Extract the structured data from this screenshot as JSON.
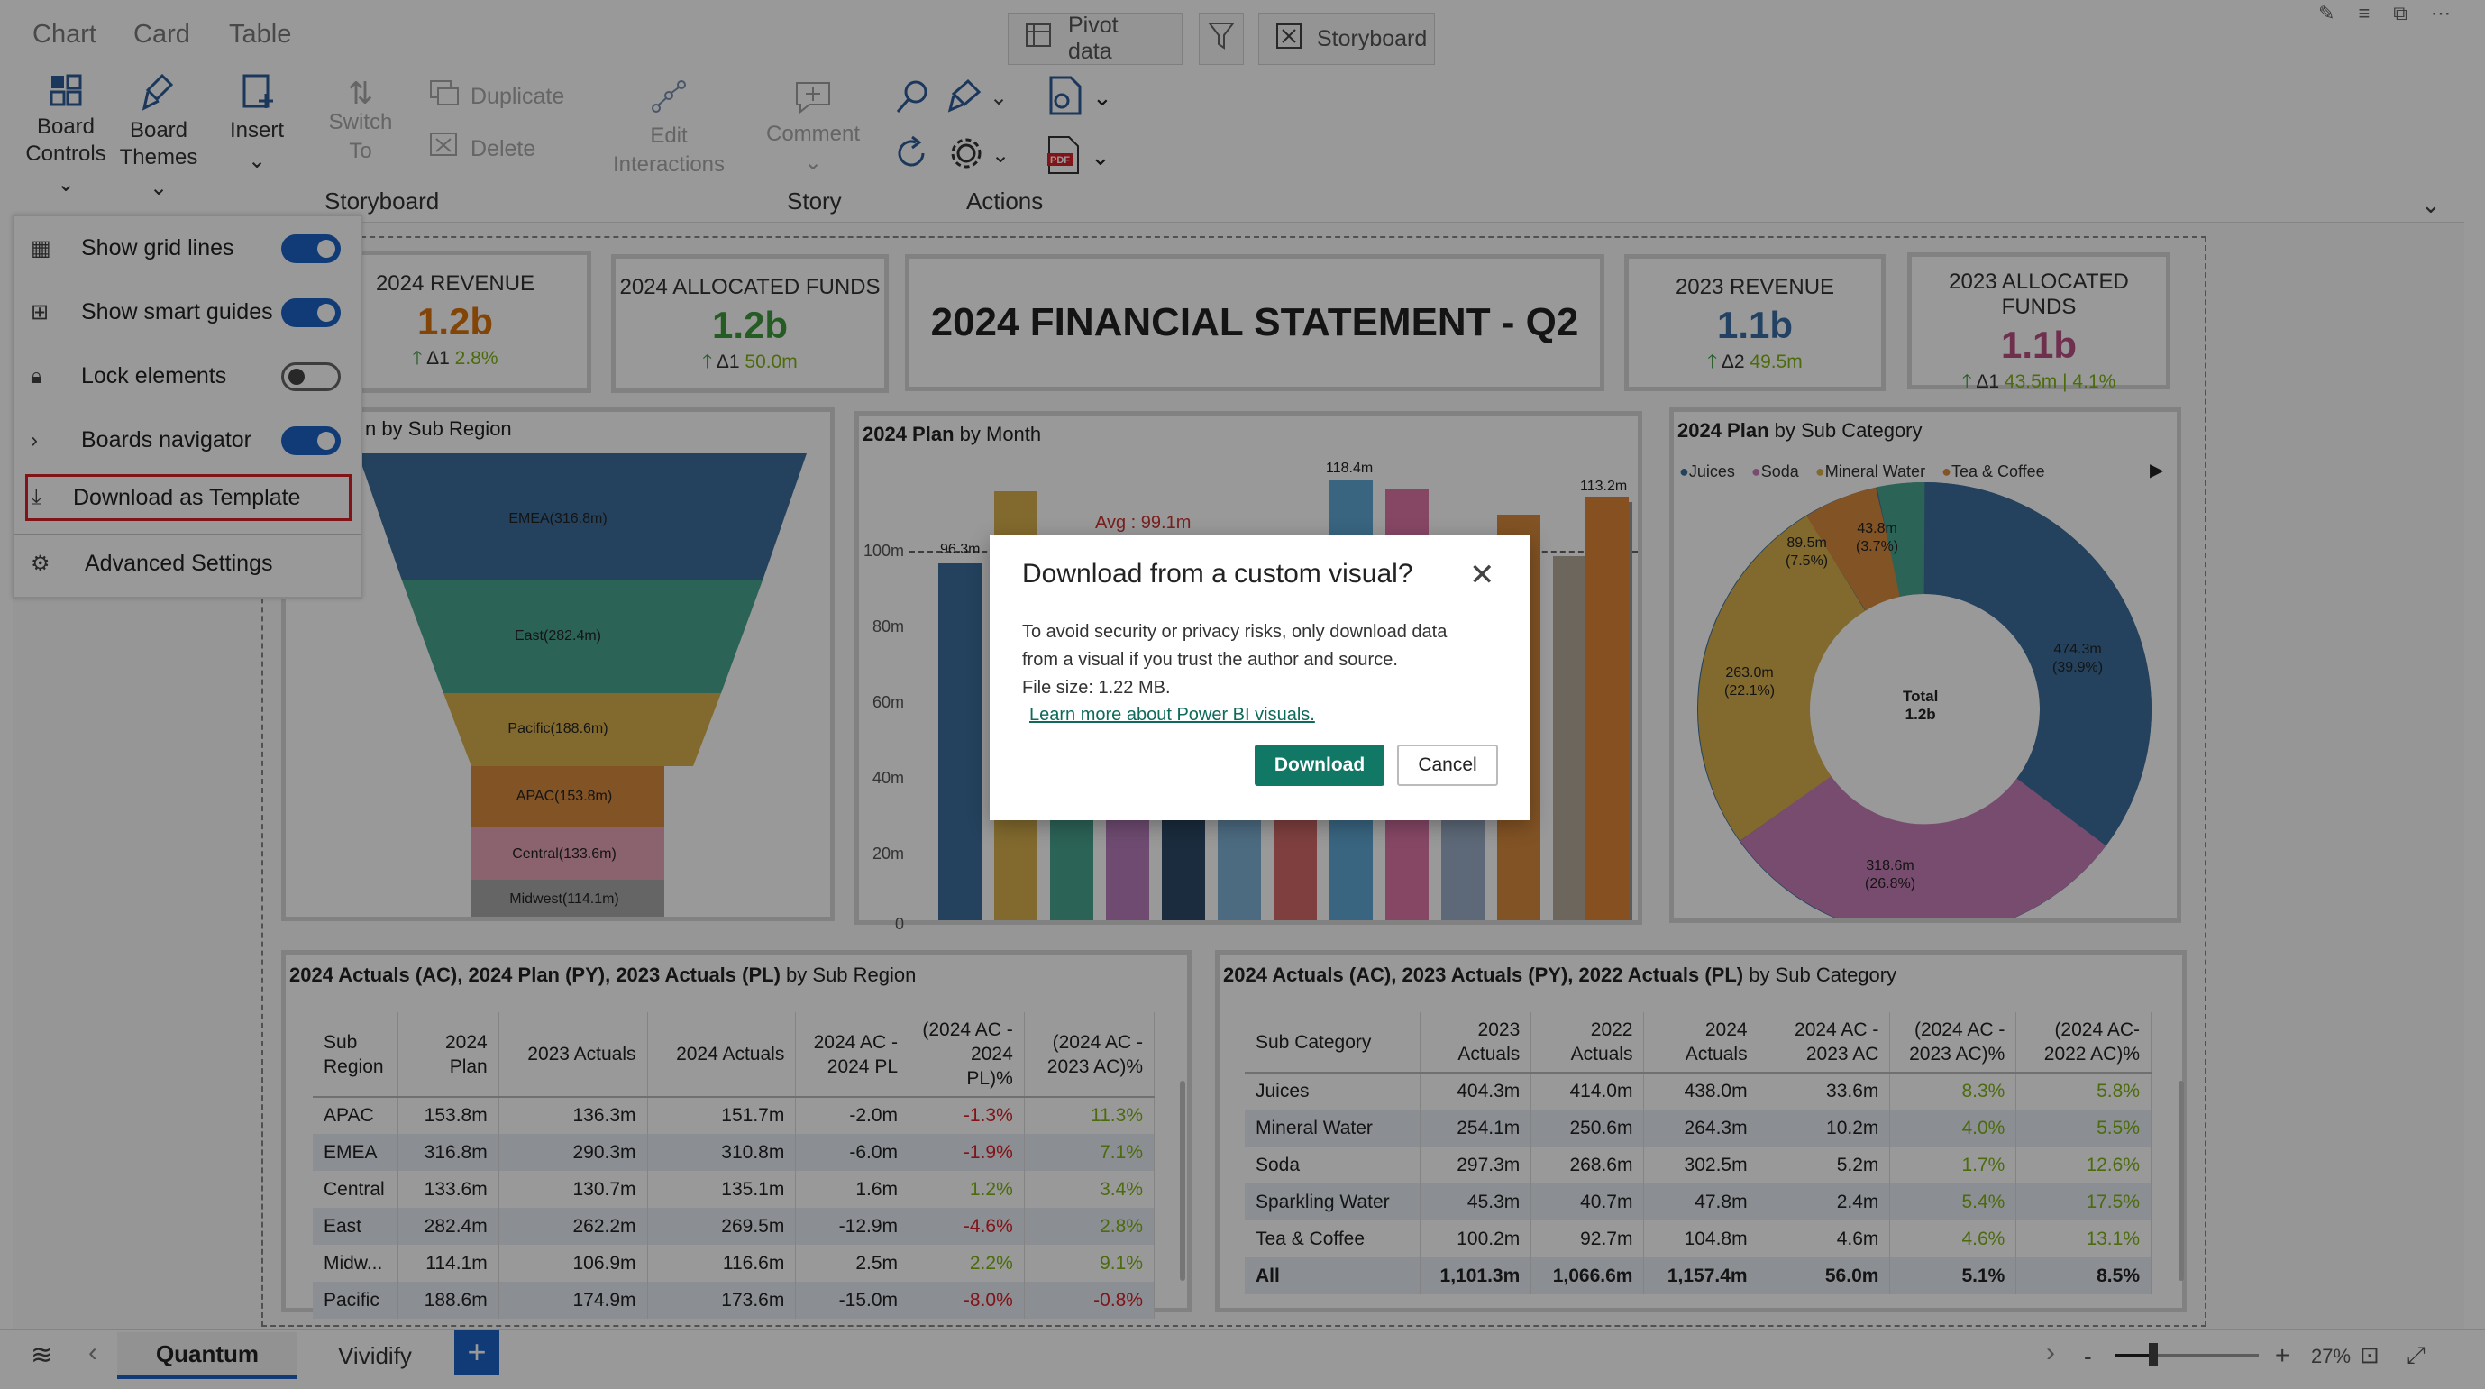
{
  "top_tabs": [
    "Chart",
    "Card",
    "Table"
  ],
  "top_buttons": {
    "pivot": "Pivot data",
    "storyboard": "Storyboard"
  },
  "ribbon": {
    "board_controls": [
      "Board",
      "Controls"
    ],
    "board_themes": [
      "Board",
      "Themes"
    ],
    "insert": "Insert",
    "switch_to": [
      "Switch",
      "To"
    ],
    "duplicate": "Duplicate",
    "delete": "Delete",
    "edit_interactions": [
      "Edit",
      "Interactions"
    ],
    "comment": "Comment",
    "groups": {
      "storyboard": "Storyboard",
      "story": "Story",
      "actions": "Actions"
    },
    "pdf_label": "PDF"
  },
  "board_controls_menu": [
    {
      "label": "Show grid lines",
      "toggle": true
    },
    {
      "label": "Show smart guides",
      "toggle": true
    },
    {
      "label": "Lock elements",
      "toggle": false
    },
    {
      "label": "Boards navigator",
      "toggle": true
    },
    {
      "label": "Download as Template"
    },
    {
      "label": "Advanced Settings"
    }
  ],
  "kpis": [
    {
      "title": "2024 REVENUE",
      "value": "1.2b",
      "delta": "Δ1",
      "change": "2.8%",
      "color": "#d9730d"
    },
    {
      "title": "2024 ALLOCATED FUNDS",
      "value": "1.2b",
      "delta": "Δ1",
      "change": "50.0m",
      "color": "#3d9a3d"
    },
    {
      "title": "2023 REVENUE",
      "value": "1.1b",
      "delta": "Δ2",
      "change": "49.5m",
      "color": "#3b6ea5"
    },
    {
      "title": "2023 ALLOCATED FUNDS",
      "value": "1.1b",
      "delta": "Δ1",
      "change": "43.5m | 4.1%",
      "color": "#b94f82"
    }
  ],
  "header_title": "2024 FINANCIAL STATEMENT - Q2",
  "funnel": {
    "title_tail": "n by Sub Region",
    "stages": [
      "EMEA(316.8m)",
      "East(282.4m)",
      "Pacific(188.6m)",
      "APAC(153.8m)",
      "Central(133.6m)",
      "Midwest(114.1m)"
    ],
    "values": [
      316.8,
      282.4,
      188.6,
      153.8,
      133.6,
      114.1
    ]
  },
  "plan_chart": {
    "title_bold": "2024 Plan",
    "title_rest": "by Month",
    "avg_label": "Avg : 99.1m",
    "y_ticks": [
      "100m",
      "80m",
      "60m",
      "40m",
      "20m",
      "0"
    ],
    "labels": {
      "first": "96.3m",
      "max": "118.4m",
      "last": "113.2m"
    }
  },
  "donut": {
    "title_bold": "2024 Plan",
    "title_rest": "by Sub Category",
    "legend": [
      "Juices",
      "Soda",
      "Mineral Water",
      "Tea & Coffee"
    ],
    "slices": [
      {
        "name": "Juices",
        "value": 474.3,
        "label": "474.3m",
        "pct": "(39.9%)"
      },
      {
        "name": "Soda",
        "value": 318.6,
        "label": "318.6m",
        "pct": "(26.8%)"
      },
      {
        "name": "Mineral Water",
        "value": 263.0,
        "label": "263.0m",
        "pct": "(22.1%)"
      },
      {
        "name": "Tea & Coffee",
        "value": 89.5,
        "label": "89.5m",
        "pct": "(7.5%)"
      },
      {
        "name": "Sparkling Water",
        "value": 43.8,
        "label": "43.8m",
        "pct": "(3.7%)"
      }
    ],
    "center": [
      "Total",
      "1.2b"
    ]
  },
  "table1": {
    "title_bold": "2024 Actuals (AC), 2024 Plan (PY), 2023 Actuals (PL)",
    "title_rest": "by Sub Region",
    "headers": [
      "Sub Region",
      "2024 Plan",
      "2023 Actuals",
      "2024 Actuals",
      "2024 AC - 2024 PL",
      "(2024 AC - 2024 PL)%",
      "(2024 AC - 2023 AC)%"
    ],
    "rows": [
      [
        "APAC",
        "153.8m",
        "136.3m",
        "151.7m",
        "-2.0m",
        "-1.3%",
        "11.3%"
      ],
      [
        "EMEA",
        "316.8m",
        "290.3m",
        "310.8m",
        "-6.0m",
        "-1.9%",
        "7.1%"
      ],
      [
        "Central",
        "133.6m",
        "130.7m",
        "135.1m",
        "1.6m",
        "1.2%",
        "3.4%"
      ],
      [
        "East",
        "282.4m",
        "262.2m",
        "269.5m",
        "-12.9m",
        "-4.6%",
        "2.8%"
      ],
      [
        "Midw...",
        "114.1m",
        "106.9m",
        "116.6m",
        "2.5m",
        "2.2%",
        "9.1%"
      ],
      [
        "Pacific",
        "188.6m",
        "174.9m",
        "173.6m",
        "-15.0m",
        "-8.0%",
        "-0.8%"
      ]
    ]
  },
  "table2": {
    "title_bold": "2024 Actuals (AC), 2023 Actuals (PY), 2022 Actuals (PL)",
    "title_rest": "by Sub Category",
    "headers": [
      "Sub Category",
      "2023 Actuals",
      "2022 Actuals",
      "2024 Actuals",
      "2024 AC - 2023 AC",
      "(2024 AC - 2023 AC)%",
      "(2024 AC- 2022 AC)%"
    ],
    "rows": [
      [
        "Juices",
        "404.3m",
        "414.0m",
        "438.0m",
        "33.6m",
        "8.3%",
        "5.8%"
      ],
      [
        "Mineral Water",
        "254.1m",
        "250.6m",
        "264.3m",
        "10.2m",
        "4.0%",
        "5.5%"
      ],
      [
        "Soda",
        "297.3m",
        "268.6m",
        "302.5m",
        "5.2m",
        "1.7%",
        "12.6%"
      ],
      [
        "Sparkling Water",
        "45.3m",
        "40.7m",
        "47.8m",
        "2.4m",
        "5.4%",
        "17.5%"
      ],
      [
        "Tea & Coffee",
        "100.2m",
        "92.7m",
        "104.8m",
        "4.6m",
        "4.6%",
        "13.1%"
      ],
      [
        "All",
        "1,101.3m",
        "1,066.6m",
        "1,157.4m",
        "56.0m",
        "5.1%",
        "8.5%"
      ]
    ]
  },
  "bottom_tabs": [
    "Quantum",
    "Vividify"
  ],
  "zoom": "27%",
  "dialog": {
    "title": "Download from a custom visual?",
    "body": [
      "To avoid security or privacy risks, only download data",
      "from a visual if you trust the author and source."
    ],
    "file_size": "File size: 1.22 MB.",
    "link": "Learn more about Power BI visuals.",
    "download": "Download",
    "cancel": "Cancel"
  }
}
